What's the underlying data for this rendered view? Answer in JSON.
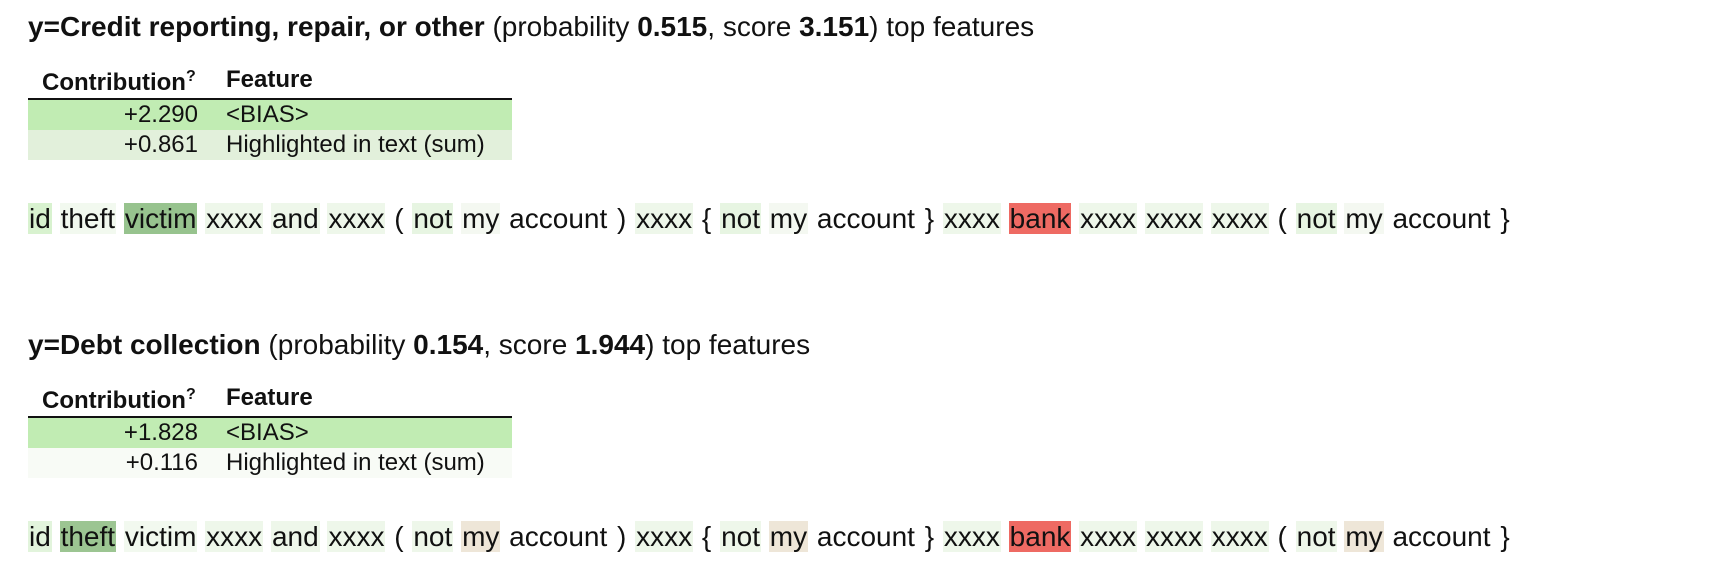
{
  "explanations": [
    {
      "label_prefix": "y=",
      "target": "Credit reporting, repair, or other",
      "prob_open": " (probability ",
      "probability": "0.515",
      "score_text": ", score ",
      "score": "3.151",
      "suffix": ") top features",
      "table": {
        "headers": {
          "contribution": "Contribution",
          "help": "?",
          "feature": "Feature"
        },
        "rows": [
          {
            "contribution": "+2.290",
            "feature": "<BIAS>",
            "bg": "#c1ecb3"
          },
          {
            "contribution": "+0.861",
            "feature": "Highlighted in text (sum)",
            "bg": "#e2f0db"
          }
        ]
      },
      "tokens": [
        {
          "t": "id",
          "bg": "#d8f2cf"
        },
        {
          "t": "theft",
          "bg": "#f2f9ef"
        },
        {
          "t": "victim",
          "bg": "#97c38e"
        },
        {
          "t": "xxxx",
          "bg": "#eef7ea"
        },
        {
          "t": "and",
          "bg": "#eef7ea"
        },
        {
          "t": "xxxx",
          "bg": "#eef7ea"
        },
        {
          "t": "(",
          "bg": "#ffffff"
        },
        {
          "t": "not",
          "bg": "#e7f5e2"
        },
        {
          "t": "my",
          "bg": "#f4f8f1"
        },
        {
          "t": "account",
          "bg": "#ffffff"
        },
        {
          "t": ")",
          "bg": "#ffffff"
        },
        {
          "t": "xxxx",
          "bg": "#eef7ea"
        },
        {
          "t": "{",
          "bg": "#ffffff"
        },
        {
          "t": "not",
          "bg": "#e7f5e2"
        },
        {
          "t": "my",
          "bg": "#f4f8f1"
        },
        {
          "t": "account",
          "bg": "#ffffff"
        },
        {
          "t": "}",
          "bg": "#ffffff"
        },
        {
          "t": "xxxx",
          "bg": "#eef7ea"
        },
        {
          "t": "bank",
          "bg": "#ee6a63"
        },
        {
          "t": "xxxx",
          "bg": "#eef7ea"
        },
        {
          "t": "xxxx",
          "bg": "#eef7ea"
        },
        {
          "t": "xxxx",
          "bg": "#eef7ea"
        },
        {
          "t": "(",
          "bg": "#ffffff"
        },
        {
          "t": "not",
          "bg": "#e7f5e2"
        },
        {
          "t": "my",
          "bg": "#f4f8f1"
        },
        {
          "t": "account",
          "bg": "#ffffff"
        },
        {
          "t": "}",
          "bg": "#ffffff"
        }
      ]
    },
    {
      "label_prefix": "y=",
      "target": "Debt collection",
      "prob_open": " (probability ",
      "probability": "0.154",
      "score_text": ", score ",
      "score": "1.944",
      "suffix": ") top features",
      "table": {
        "headers": {
          "contribution": "Contribution",
          "help": "?",
          "feature": "Feature"
        },
        "rows": [
          {
            "contribution": "+1.828",
            "feature": "<BIAS>",
            "bg": "#c1ecb3"
          },
          {
            "contribution": "+0.116",
            "feature": "Highlighted in text (sum)",
            "bg": "#f8fbf6"
          }
        ]
      },
      "tokens": [
        {
          "t": "id",
          "bg": "#e2f4dc"
        },
        {
          "t": "theft",
          "bg": "#9cc592"
        },
        {
          "t": "victim",
          "bg": "#f2f9ef"
        },
        {
          "t": "xxxx",
          "bg": "#eef7ea"
        },
        {
          "t": "and",
          "bg": "#eef7ea"
        },
        {
          "t": "xxxx",
          "bg": "#eef7ea"
        },
        {
          "t": "(",
          "bg": "#ffffff"
        },
        {
          "t": "not",
          "bg": "#eef7ea"
        },
        {
          "t": "my",
          "bg": "#eee6d8"
        },
        {
          "t": "account",
          "bg": "#ffffff"
        },
        {
          "t": ")",
          "bg": "#ffffff"
        },
        {
          "t": "xxxx",
          "bg": "#eef7ea"
        },
        {
          "t": "{",
          "bg": "#ffffff"
        },
        {
          "t": "not",
          "bg": "#eef7ea"
        },
        {
          "t": "my",
          "bg": "#eee6d8"
        },
        {
          "t": "account",
          "bg": "#ffffff"
        },
        {
          "t": "}",
          "bg": "#ffffff"
        },
        {
          "t": "xxxx",
          "bg": "#eef7ea"
        },
        {
          "t": "bank",
          "bg": "#ee6a63"
        },
        {
          "t": "xxxx",
          "bg": "#eef7ea"
        },
        {
          "t": "xxxx",
          "bg": "#eef7ea"
        },
        {
          "t": "xxxx",
          "bg": "#eef7ea"
        },
        {
          "t": "(",
          "bg": "#ffffff"
        },
        {
          "t": "not",
          "bg": "#eef7ea"
        },
        {
          "t": "my",
          "bg": "#eee6d8"
        },
        {
          "t": "account",
          "bg": "#ffffff"
        },
        {
          "t": "}",
          "bg": "#ffffff"
        }
      ]
    }
  ]
}
